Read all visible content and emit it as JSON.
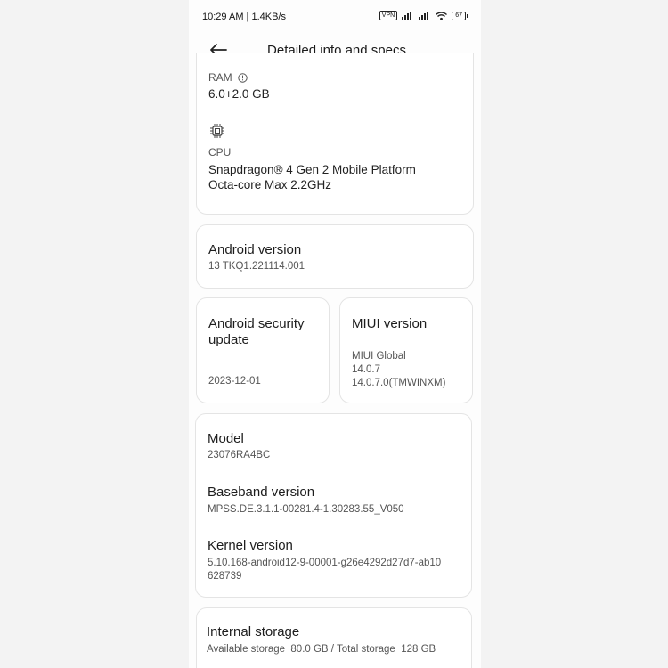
{
  "status_bar": {
    "time": "10:29 AM | 1.4KB/s",
    "vpn": "VPN",
    "battery": "67"
  },
  "header": {
    "title": "Detailed info and specs"
  },
  "ram": {
    "label": "RAM",
    "value": "6.0+2.0 GB"
  },
  "cpu": {
    "label": "CPU",
    "line1": "Snapdragon® 4 Gen 2 Mobile Platform",
    "line2": "Octa-core Max 2.2GHz"
  },
  "android_version": {
    "label": "Android version",
    "value": "13 TKQ1.221114.001"
  },
  "security_update": {
    "label_line1": "Android security",
    "label_line2": "update",
    "value": "2023-12-01"
  },
  "miui_version": {
    "label": "MIUI version",
    "line1": "MIUI Global",
    "line2": "14.0.7",
    "line3": "14.0.7.0(TMWINXM)"
  },
  "model": {
    "label": "Model",
    "value": "23076RA4BC"
  },
  "baseband": {
    "label": "Baseband version",
    "value": "MPSS.DE.3.1.1-00281.4-1.30283.55_V050"
  },
  "kernel": {
    "label": "Kernel version",
    "line1": "5.10.168-android12-9-00001-g26e4292d27d7-ab10",
    "line2": "628739"
  },
  "storage": {
    "label": "Internal storage",
    "value": "Available storage  80.0 GB / Total storage  128 GB"
  }
}
